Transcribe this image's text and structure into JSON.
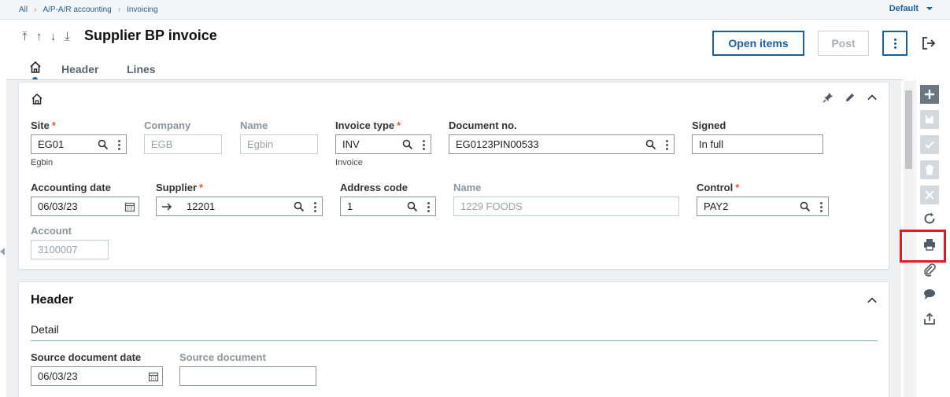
{
  "breadcrumb": [
    "All",
    "A/P-A/R accounting",
    "Invoicing"
  ],
  "profile_selector": "Default",
  "page": {
    "title": "Supplier BP invoice"
  },
  "actions": {
    "open_items": "Open items",
    "post": "Post"
  },
  "tabs": {
    "header": "Header",
    "lines": "Lines"
  },
  "form": {
    "site": {
      "label": "Site",
      "value": "EG01",
      "sub": "Egbin",
      "required": true
    },
    "company": {
      "label": "Company",
      "value": "EGB"
    },
    "name": {
      "label": "Name",
      "value": "Egbin"
    },
    "invoice_type": {
      "label": "Invoice type",
      "value": "INV",
      "sub": "Invoice",
      "required": true
    },
    "document_no": {
      "label": "Document no.",
      "value": "EG0123PIN00533"
    },
    "signed": {
      "label": "Signed",
      "value": "In full"
    },
    "accounting_date": {
      "label": "Accounting date",
      "value": "06/03/23"
    },
    "supplier": {
      "label": "Supplier",
      "value": "12201",
      "required": true
    },
    "address_code": {
      "label": "Address code",
      "value": "1"
    },
    "supplier_name": {
      "label": "Name",
      "value": "1229 FOODS"
    },
    "control": {
      "label": "Control",
      "value": "PAY2",
      "required": true
    },
    "account": {
      "label": "Account",
      "value": "3100007"
    }
  },
  "header_section": {
    "title": "Header",
    "subtitle": "Detail",
    "source_document_date": {
      "label": "Source document date",
      "value": "06/03/23"
    },
    "source_document": {
      "label": "Source document",
      "value": ""
    }
  },
  "required_mark": "*",
  "colors": {
    "accent": "#1a5f9e",
    "required": "#e25a2d",
    "highlight": "#e21b23"
  }
}
